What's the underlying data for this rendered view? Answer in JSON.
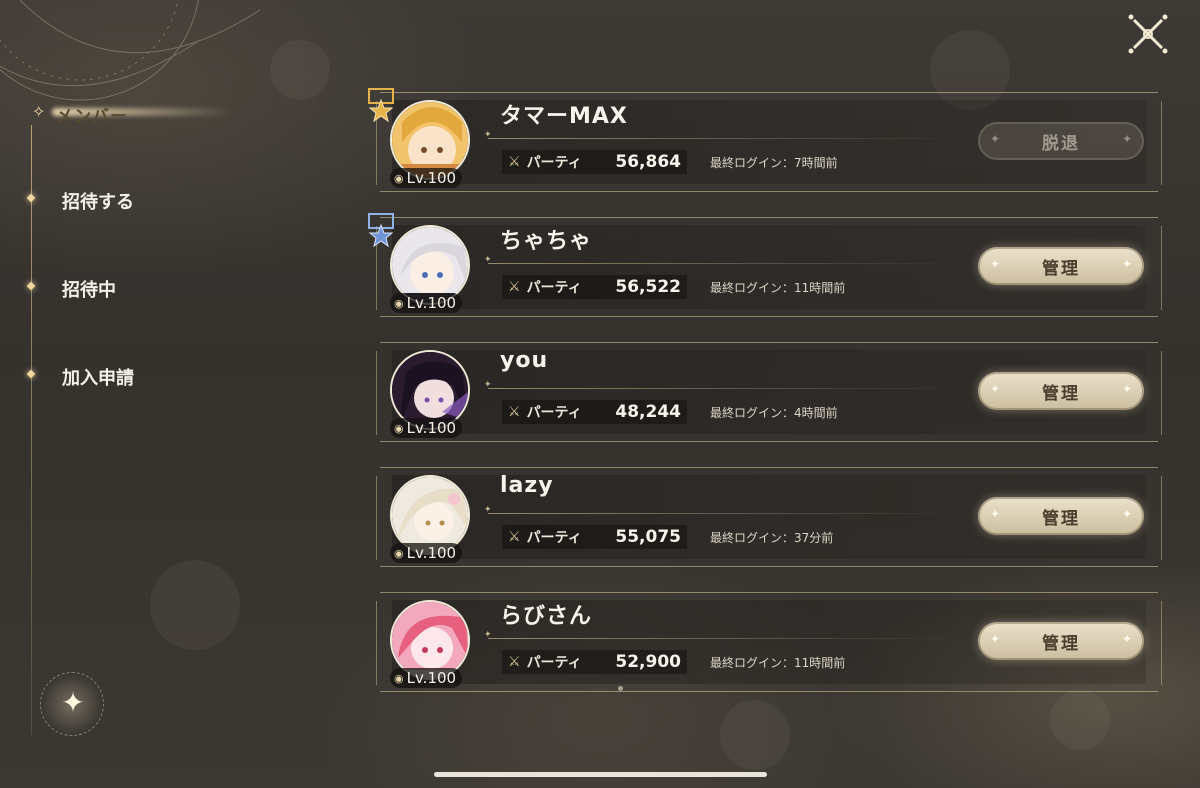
{
  "sidebar": {
    "active_label": "メンバー",
    "items": [
      {
        "label": "招待する"
      },
      {
        "label": "招待中"
      },
      {
        "label": "加入申請"
      }
    ]
  },
  "members": [
    {
      "name": "タマーMAX",
      "level": "Lv.100",
      "party_label": "パーティ",
      "party_power": "56,864",
      "last_login": "最終ログイン：7時間前",
      "action": "脱退",
      "action_enabled": false,
      "role_badge": "leader-gold"
    },
    {
      "name": "ちゃちゃ",
      "level": "Lv.100",
      "party_label": "パーティ",
      "party_power": "56,522",
      "last_login": "最終ログイン：11時間前",
      "action": "管理",
      "action_enabled": true,
      "role_badge": "sub-leader-blue"
    },
    {
      "name": "you",
      "level": "Lv.100",
      "party_label": "パーティ",
      "party_power": "48,244",
      "last_login": "最終ログイン：4時間前",
      "action": "管理",
      "action_enabled": true
    },
    {
      "name": "lazy",
      "level": "Lv.100",
      "party_label": "パーティ",
      "party_power": "55,075",
      "last_login": "最終ログイン：37分前",
      "action": "管理",
      "action_enabled": true
    },
    {
      "name": "らびさん",
      "level": "Lv.100",
      "party_label": "パーティ",
      "party_power": "52,900",
      "last_login": "最終ログイン：11時間前",
      "action": "管理",
      "action_enabled": true
    }
  ],
  "icons": {
    "close": "close-icon",
    "party": "crossed-swords-icon",
    "level": "level-icon",
    "sparkle": "sparkle-icon"
  },
  "colors": {
    "background": "#38342f",
    "accent_gold": "#e7cf98",
    "leader_badge": "#e5b34a",
    "sub_leader_badge": "#8fb2e6",
    "manage_button": "#e2d6bb"
  }
}
